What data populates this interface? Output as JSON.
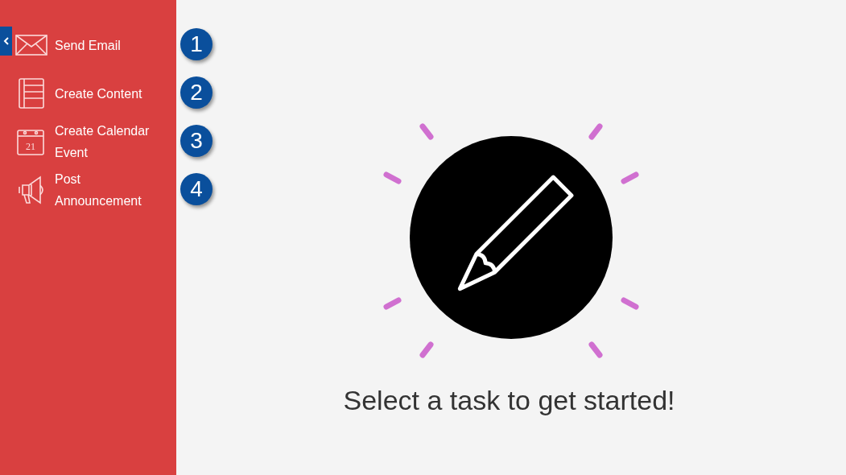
{
  "sidebar": {
    "items": [
      {
        "kind": "email",
        "label": "Send Email",
        "badge": "1"
      },
      {
        "kind": "content",
        "label": "Create Content",
        "badge": "2"
      },
      {
        "kind": "calendar",
        "label": "Create Calendar Event",
        "badge": "3",
        "icon_text": "21"
      },
      {
        "kind": "announcement",
        "label": "Post Announcement",
        "badge": "4"
      }
    ]
  },
  "main": {
    "message": "Select a task to get started!"
  }
}
